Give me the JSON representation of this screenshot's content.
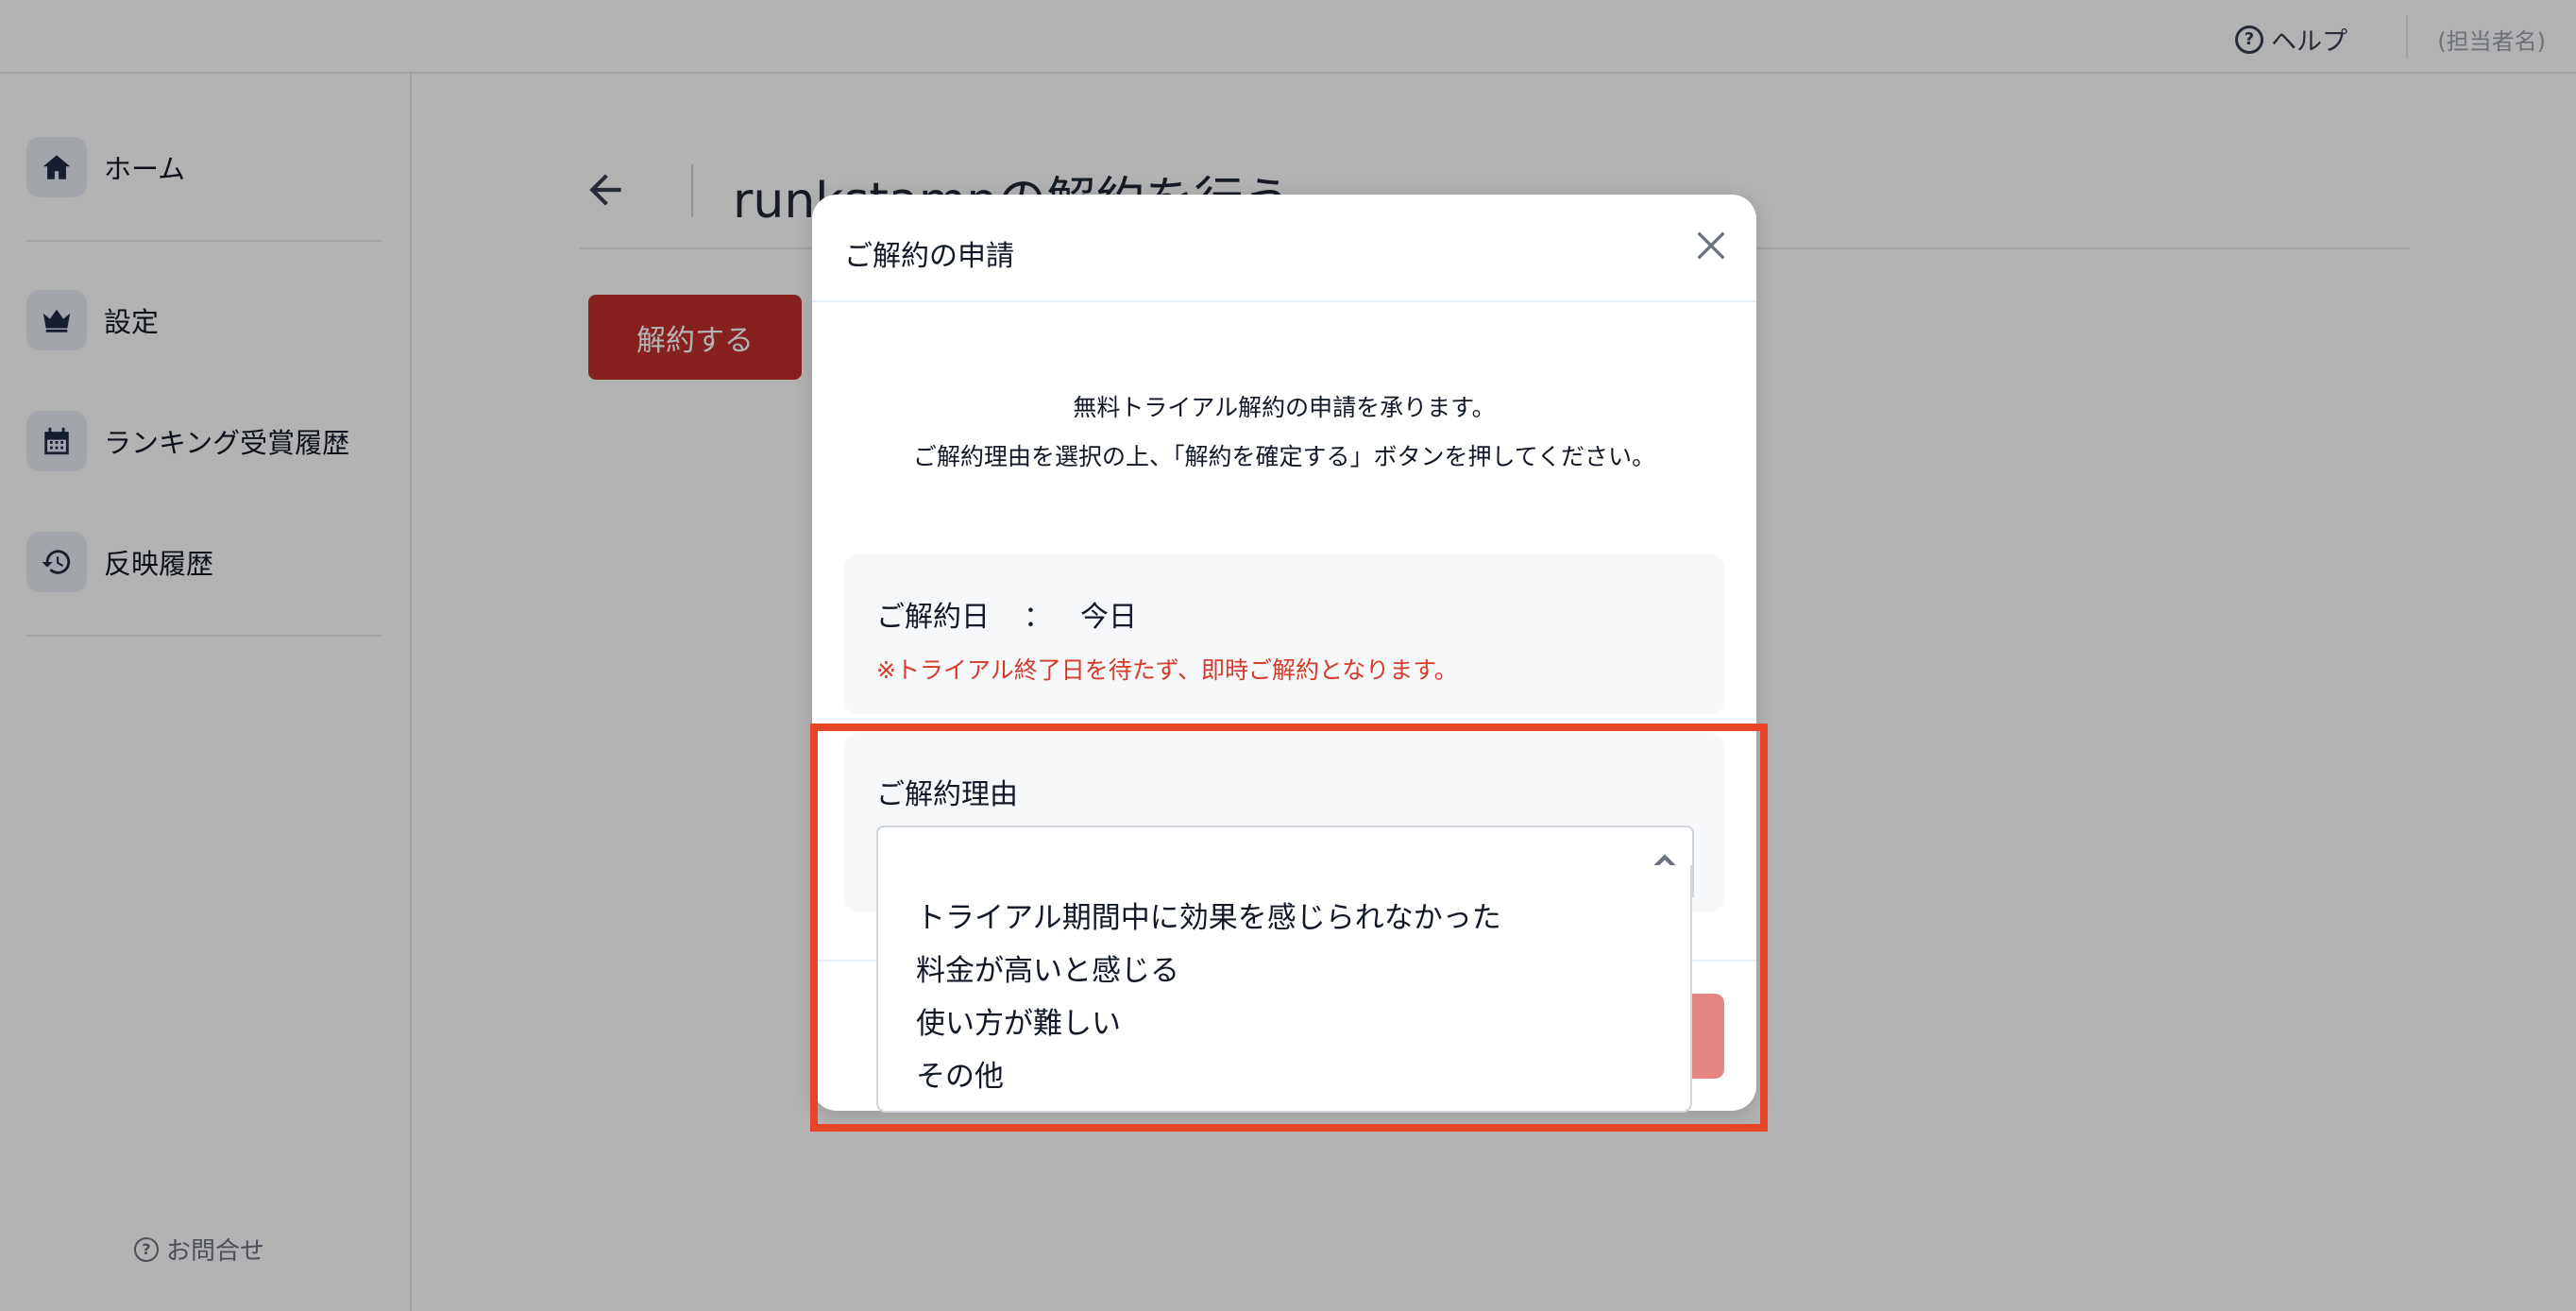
{
  "header": {
    "help_label": "ヘルプ",
    "user_name": "(担当者名)"
  },
  "sidebar": {
    "items": [
      {
        "label": "ホーム",
        "icon": "home-icon"
      },
      {
        "label": "設定",
        "icon": "crown-icon"
      },
      {
        "label": "ランキング受賞履歴",
        "icon": "calendar-icon"
      },
      {
        "label": "反映履歴",
        "icon": "history-icon"
      }
    ],
    "contact_label": "お問合せ"
  },
  "main": {
    "title": "runkstampの解約を行う",
    "cancel_button": "解約する"
  },
  "modal": {
    "title": "ご解約の申請",
    "intro_line1": "無料トライアル解約の申請を承ります。",
    "intro_line2": "ご解約理由を選択の上、「解約を確定する」ボタンを押してください。",
    "date_label": "ご解約日",
    "date_colon": "：",
    "date_value": "今日",
    "date_note": "※トライアル終了日を待たず、即時ご解約となります。",
    "reason_label": "ご解約理由",
    "reason_options": [
      "トライアル期間中に効果を感じられなかった",
      "料金が高いと感じる",
      "使い方が難しい",
      "その他"
    ]
  },
  "colors": {
    "primary_red": "#c0302b",
    "confirm_red_light": "#e58582",
    "note_red": "#d63a2a",
    "highlight": "#e8442a"
  }
}
